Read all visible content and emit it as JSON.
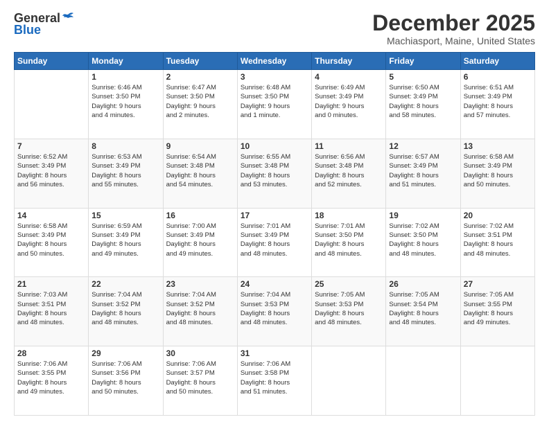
{
  "header": {
    "logo_general": "General",
    "logo_blue": "Blue",
    "month": "December 2025",
    "location": "Machiasport, Maine, United States"
  },
  "weekdays": [
    "Sunday",
    "Monday",
    "Tuesday",
    "Wednesday",
    "Thursday",
    "Friday",
    "Saturday"
  ],
  "weeks": [
    [
      {
        "day": "",
        "info": ""
      },
      {
        "day": "1",
        "info": "Sunrise: 6:46 AM\nSunset: 3:50 PM\nDaylight: 9 hours\nand 4 minutes."
      },
      {
        "day": "2",
        "info": "Sunrise: 6:47 AM\nSunset: 3:50 PM\nDaylight: 9 hours\nand 2 minutes."
      },
      {
        "day": "3",
        "info": "Sunrise: 6:48 AM\nSunset: 3:50 PM\nDaylight: 9 hours\nand 1 minute."
      },
      {
        "day": "4",
        "info": "Sunrise: 6:49 AM\nSunset: 3:49 PM\nDaylight: 9 hours\nand 0 minutes."
      },
      {
        "day": "5",
        "info": "Sunrise: 6:50 AM\nSunset: 3:49 PM\nDaylight: 8 hours\nand 58 minutes."
      },
      {
        "day": "6",
        "info": "Sunrise: 6:51 AM\nSunset: 3:49 PM\nDaylight: 8 hours\nand 57 minutes."
      }
    ],
    [
      {
        "day": "7",
        "info": "Sunrise: 6:52 AM\nSunset: 3:49 PM\nDaylight: 8 hours\nand 56 minutes."
      },
      {
        "day": "8",
        "info": "Sunrise: 6:53 AM\nSunset: 3:49 PM\nDaylight: 8 hours\nand 55 minutes."
      },
      {
        "day": "9",
        "info": "Sunrise: 6:54 AM\nSunset: 3:48 PM\nDaylight: 8 hours\nand 54 minutes."
      },
      {
        "day": "10",
        "info": "Sunrise: 6:55 AM\nSunset: 3:48 PM\nDaylight: 8 hours\nand 53 minutes."
      },
      {
        "day": "11",
        "info": "Sunrise: 6:56 AM\nSunset: 3:48 PM\nDaylight: 8 hours\nand 52 minutes."
      },
      {
        "day": "12",
        "info": "Sunrise: 6:57 AM\nSunset: 3:49 PM\nDaylight: 8 hours\nand 51 minutes."
      },
      {
        "day": "13",
        "info": "Sunrise: 6:58 AM\nSunset: 3:49 PM\nDaylight: 8 hours\nand 50 minutes."
      }
    ],
    [
      {
        "day": "14",
        "info": "Sunrise: 6:58 AM\nSunset: 3:49 PM\nDaylight: 8 hours\nand 50 minutes."
      },
      {
        "day": "15",
        "info": "Sunrise: 6:59 AM\nSunset: 3:49 PM\nDaylight: 8 hours\nand 49 minutes."
      },
      {
        "day": "16",
        "info": "Sunrise: 7:00 AM\nSunset: 3:49 PM\nDaylight: 8 hours\nand 49 minutes."
      },
      {
        "day": "17",
        "info": "Sunrise: 7:01 AM\nSunset: 3:49 PM\nDaylight: 8 hours\nand 48 minutes."
      },
      {
        "day": "18",
        "info": "Sunrise: 7:01 AM\nSunset: 3:50 PM\nDaylight: 8 hours\nand 48 minutes."
      },
      {
        "day": "19",
        "info": "Sunrise: 7:02 AM\nSunset: 3:50 PM\nDaylight: 8 hours\nand 48 minutes."
      },
      {
        "day": "20",
        "info": "Sunrise: 7:02 AM\nSunset: 3:51 PM\nDaylight: 8 hours\nand 48 minutes."
      }
    ],
    [
      {
        "day": "21",
        "info": "Sunrise: 7:03 AM\nSunset: 3:51 PM\nDaylight: 8 hours\nand 48 minutes."
      },
      {
        "day": "22",
        "info": "Sunrise: 7:04 AM\nSunset: 3:52 PM\nDaylight: 8 hours\nand 48 minutes."
      },
      {
        "day": "23",
        "info": "Sunrise: 7:04 AM\nSunset: 3:52 PM\nDaylight: 8 hours\nand 48 minutes."
      },
      {
        "day": "24",
        "info": "Sunrise: 7:04 AM\nSunset: 3:53 PM\nDaylight: 8 hours\nand 48 minutes."
      },
      {
        "day": "25",
        "info": "Sunrise: 7:05 AM\nSunset: 3:53 PM\nDaylight: 8 hours\nand 48 minutes."
      },
      {
        "day": "26",
        "info": "Sunrise: 7:05 AM\nSunset: 3:54 PM\nDaylight: 8 hours\nand 48 minutes."
      },
      {
        "day": "27",
        "info": "Sunrise: 7:05 AM\nSunset: 3:55 PM\nDaylight: 8 hours\nand 49 minutes."
      }
    ],
    [
      {
        "day": "28",
        "info": "Sunrise: 7:06 AM\nSunset: 3:55 PM\nDaylight: 8 hours\nand 49 minutes."
      },
      {
        "day": "29",
        "info": "Sunrise: 7:06 AM\nSunset: 3:56 PM\nDaylight: 8 hours\nand 50 minutes."
      },
      {
        "day": "30",
        "info": "Sunrise: 7:06 AM\nSunset: 3:57 PM\nDaylight: 8 hours\nand 50 minutes."
      },
      {
        "day": "31",
        "info": "Sunrise: 7:06 AM\nSunset: 3:58 PM\nDaylight: 8 hours\nand 51 minutes."
      },
      {
        "day": "",
        "info": ""
      },
      {
        "day": "",
        "info": ""
      },
      {
        "day": "",
        "info": ""
      }
    ]
  ]
}
